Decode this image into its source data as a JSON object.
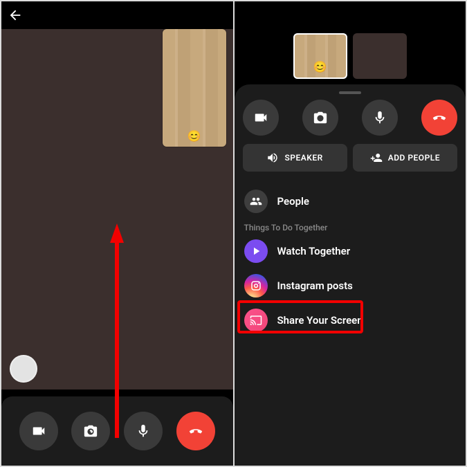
{
  "icons": {
    "back": "arrow-left",
    "camera": "video-camera",
    "flip": "camera-flip",
    "mic": "microphone",
    "hangup": "phone-end",
    "shutter": "shutter",
    "smile": "😊"
  },
  "left": {
    "buttons": [
      "camera",
      "flip",
      "mic",
      "hangup"
    ]
  },
  "right": {
    "thumbs": 2,
    "controls": [
      "camera",
      "flip",
      "mic",
      "hangup"
    ],
    "speaker_label": "SPEAKER",
    "add_people_label": "ADD PEOPLE",
    "people_label": "People",
    "section_title": "Things To Do Together",
    "items": [
      {
        "label": "Watch Together",
        "icon": "play"
      },
      {
        "label": "Instagram posts",
        "icon": "instagram"
      },
      {
        "label": "Share Your Screen",
        "icon": "cast"
      }
    ]
  },
  "annotation": {
    "highlighted_item_index": 2,
    "arrow_hint": "swipe-up"
  },
  "colors": {
    "hangup": "#f24236",
    "highlight": "#f20000",
    "sheet_bg": "#1c1c1c"
  }
}
